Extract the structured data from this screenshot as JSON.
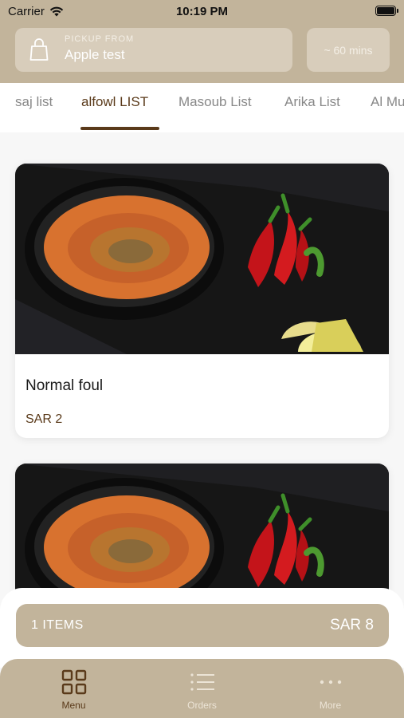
{
  "status_bar": {
    "carrier": "Carrier",
    "time": "10:19 PM"
  },
  "header": {
    "pickup_label": "PICKUP FROM",
    "pickup_location": "Apple test",
    "estimated_time": "~ 60 mins"
  },
  "tabs": [
    {
      "label": "saj list",
      "active": false
    },
    {
      "label": "alfowl LIST",
      "active": true
    },
    {
      "label": "Masoub List",
      "active": false
    },
    {
      "label": "Arika List",
      "active": false
    },
    {
      "label": "Al Mu",
      "active": false
    }
  ],
  "products": [
    {
      "name": "Normal foul",
      "price": "SAR 2",
      "image": "foul-bowl-photo"
    },
    {
      "name": "",
      "price": "",
      "image": "foul-bowl-photo"
    }
  ],
  "cart": {
    "items_label": "1 ITEMS",
    "total": "SAR 8"
  },
  "tabbar": [
    {
      "label": "Menu",
      "icon": "grid-icon",
      "active": true
    },
    {
      "label": "Orders",
      "icon": "list-icon",
      "active": false
    },
    {
      "label": "More",
      "icon": "more-dots-icon",
      "active": false
    }
  ],
  "colors": {
    "accent": "#c2b49b",
    "brown": "#5a3a1a",
    "card_bg": "#d8cdbb"
  }
}
